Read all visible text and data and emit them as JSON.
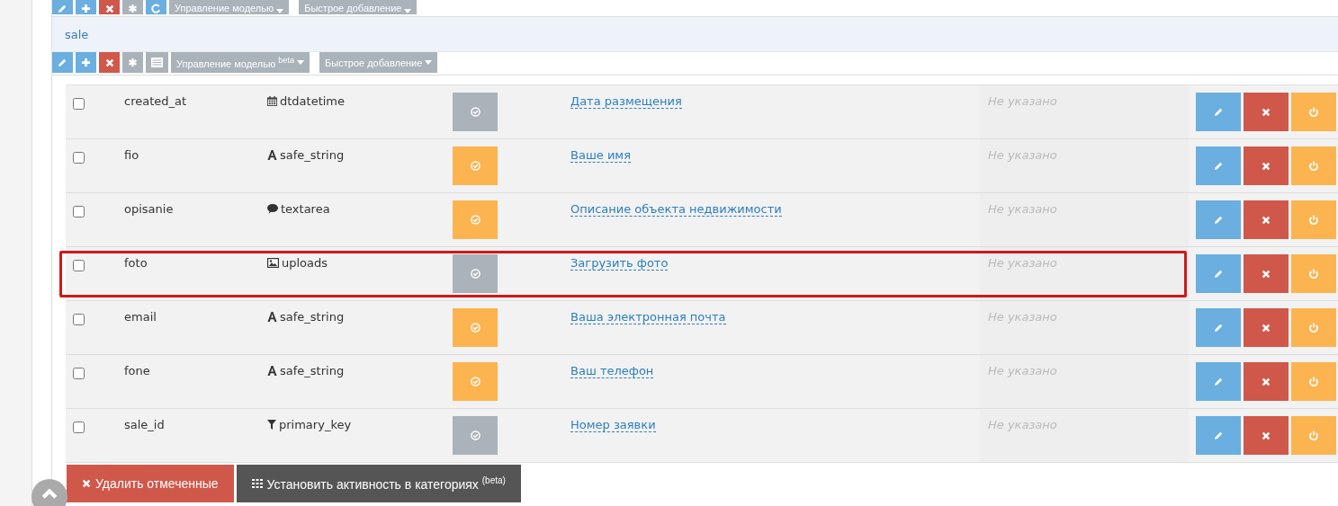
{
  "top_toolbar": {
    "menus": [
      {
        "label": "Управление моделью"
      },
      {
        "label": "Быстрое добавление"
      }
    ]
  },
  "panel": {
    "title": "sale",
    "menus": [
      {
        "label": "Управление моделью $^{beta}$"
      },
      {
        "label": "Быстрое добавление"
      }
    ]
  },
  "rows": [
    {
      "checked": false,
      "name": "created_at",
      "kind": "datetime",
      "type": "dtdatetime",
      "active": false,
      "label": "Дата размещения",
      "placeholder": "Не указано",
      "highlighted": false
    },
    {
      "checked": false,
      "name": "fio",
      "kind": "string",
      "type": "safe_string",
      "active": true,
      "label": "Ваше имя",
      "placeholder": "Не указано",
      "highlighted": false
    },
    {
      "checked": false,
      "name": "opisanie",
      "kind": "text",
      "type": "textarea",
      "active": true,
      "label": "Описание объекта недвижимости",
      "placeholder": "Не указано",
      "highlighted": false
    },
    {
      "checked": false,
      "name": "foto",
      "kind": "upload",
      "type": "uploads",
      "active": false,
      "label": "Загрузить фото",
      "placeholder": "Не указано",
      "highlighted": true
    },
    {
      "checked": false,
      "name": "email",
      "kind": "string",
      "type": "safe_string",
      "active": true,
      "label": "Ваша электронная почта",
      "placeholder": "Не указано",
      "highlighted": false
    },
    {
      "checked": false,
      "name": "fone",
      "kind": "string",
      "type": "safe_string",
      "active": true,
      "label": "Ваш телефон",
      "placeholder": "Не указано",
      "highlighted": false
    },
    {
      "checked": false,
      "name": "sale_id",
      "kind": "key",
      "type": "primary_key",
      "active": false,
      "label": "Номер заявки",
      "placeholder": "Не указано",
      "highlighted": false
    }
  ],
  "footer_buttons": [
    {
      "kind": "delete",
      "label": "Удалить отмеченные"
    },
    {
      "kind": "grid",
      "label": "Установить активность в категориях $^{(beta)}$"
    }
  ]
}
